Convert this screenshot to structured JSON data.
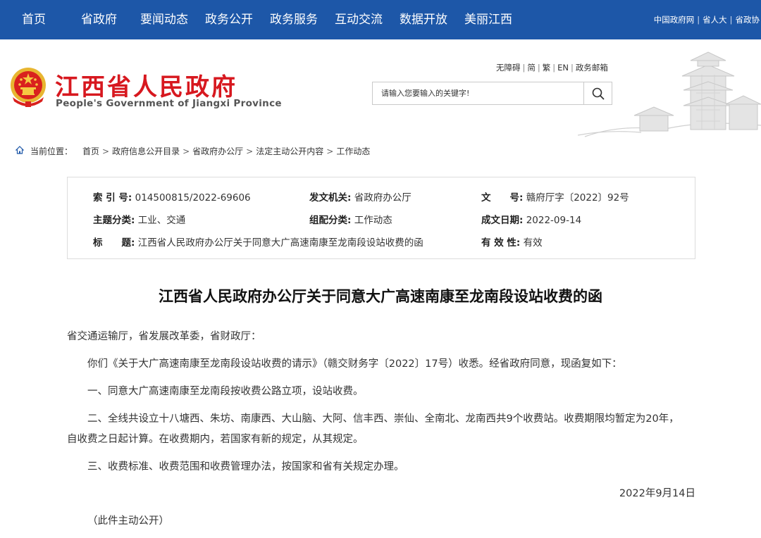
{
  "topnav": {
    "items": [
      "首页",
      "省政府",
      "要闻动态",
      "政务公开",
      "政务服务",
      "互动交流",
      "数据开放",
      "美丽江西"
    ],
    "right_links": [
      "中国政府网",
      "省人大",
      "省政协"
    ]
  },
  "header": {
    "title": "江西省人民政府",
    "subtitle": "People's Government of Jiangxi Province",
    "util_links": [
      "无障碍",
      "简",
      "繁",
      "EN",
      "政务邮箱"
    ],
    "search_placeholder": "请输入您要输入的关键字!"
  },
  "breadcrumb": {
    "label": "当前位置：",
    "items": [
      "首页",
      "政府信息公开目录",
      "省政府办公厅",
      "法定主动公开内容",
      "工作动态"
    ]
  },
  "meta": {
    "index_label": "索 引 号:",
    "index_value": "014500815/2022-69606",
    "issuer_label": "发文机关:",
    "issuer_value": "省政府办公厅",
    "docno_label": "文　　号:",
    "docno_value": "赣府厅字〔2022〕92号",
    "topic_label": "主题分类:",
    "topic_value": "工业、交通",
    "category_label": "组配分类:",
    "category_value": "工作动态",
    "date_label": "成文日期:",
    "date_value": "2022-09-14",
    "title_label": "标　　题:",
    "title_value": "江西省人民政府办公厅关于同意大广高速南康至龙南段设站收费的函",
    "validity_label": "有 效 性:",
    "validity_value": "有效"
  },
  "document": {
    "title": "江西省人民政府办公厅关于同意大广高速南康至龙南段设站收费的函",
    "salutation": "省交通运输厅，省发展改革委，省财政厅：",
    "p1": "你们《关于大广高速南康至龙南段设站收费的请示》（赣交财务字〔2022〕17号）收悉。经省政府同意，现函复如下：",
    "p2": "一、同意大广高速南康至龙南段按收费公路立项，设站收费。",
    "p3_line1": "二、全线共设立十八塘西、朱坊、南康西、大山脑、大阿、信丰西、崇仙、全南北、龙南西共9个收费站。收费期限均暂定为20年，",
    "p3_line2": "自收费之日起计算。在收费期内，若国家有新的规定，从其规定。",
    "p4": "三、收费标准、收费范围和收费管理办法，按国家和省有关规定办理。",
    "date": "2022年9月14日",
    "note": "（此件主动公开）"
  },
  "colors": {
    "nav_bg": "#1d57a8",
    "title_red": "#d7181f"
  }
}
